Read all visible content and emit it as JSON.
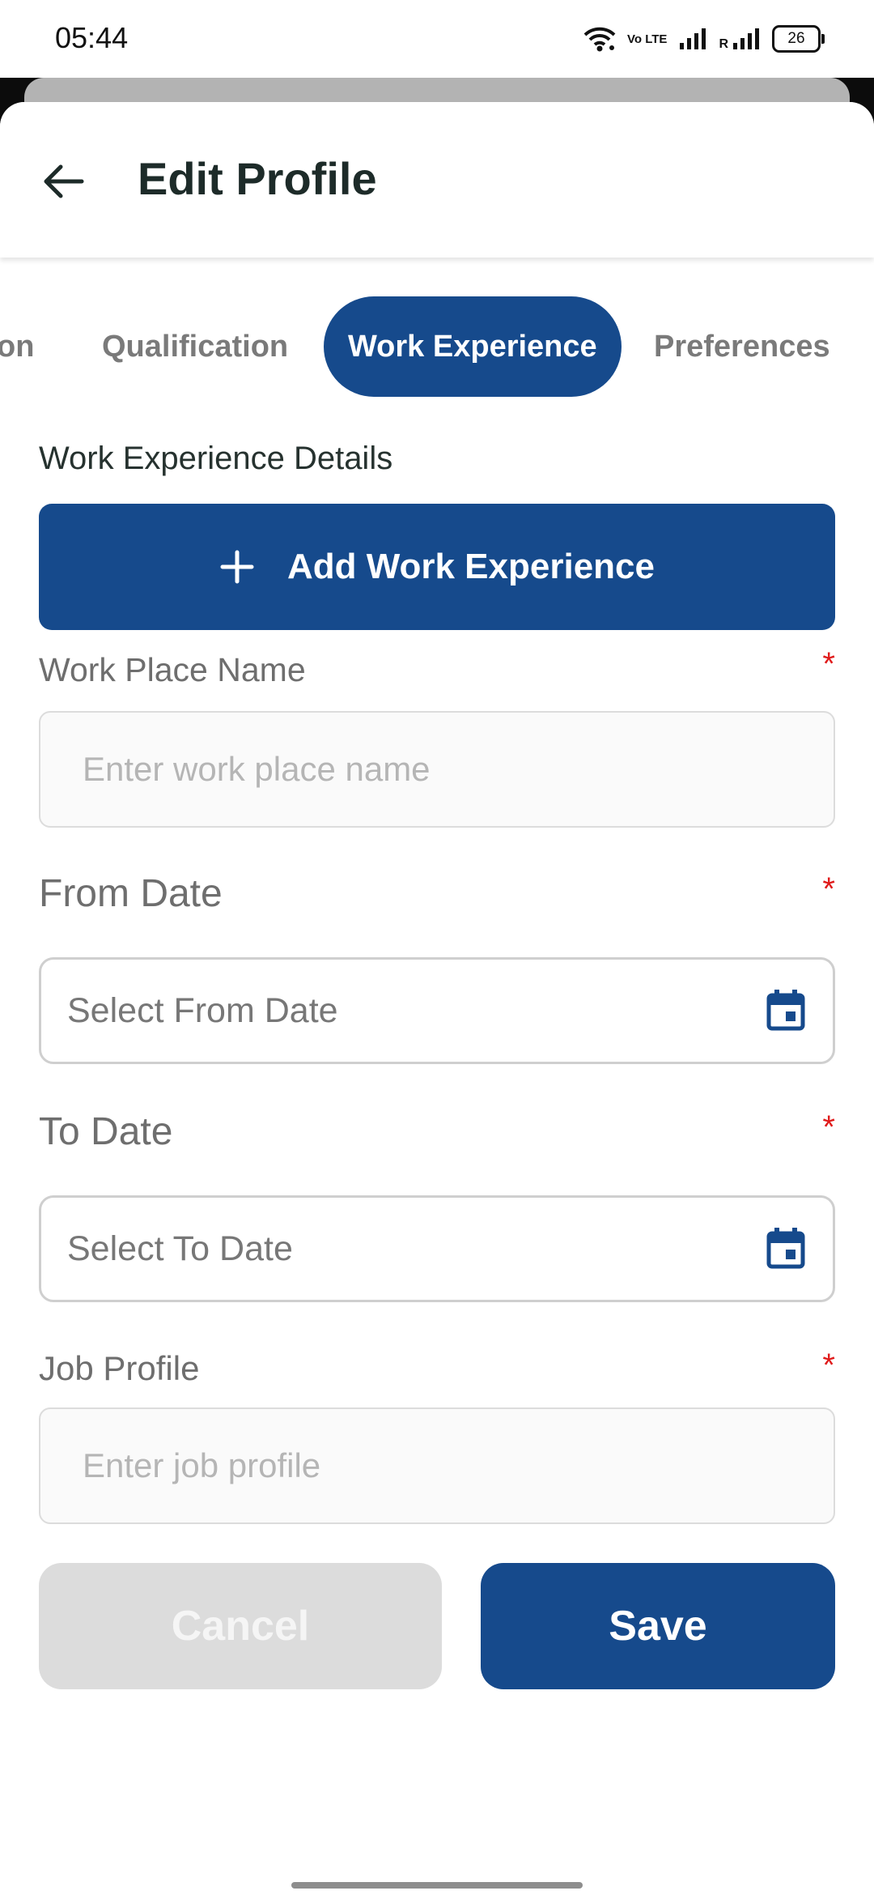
{
  "status_bar": {
    "time": "05:44",
    "volte": "Vo LTE",
    "roaming": "R",
    "battery": "26"
  },
  "header": {
    "title": "Edit Profile",
    "back_icon": "arrow-left-icon"
  },
  "tabs": [
    {
      "label": "on",
      "active": false
    },
    {
      "label": "Qualification",
      "active": false
    },
    {
      "label": "Work Experience",
      "active": true
    },
    {
      "label": "Preferences",
      "active": false
    }
  ],
  "section": {
    "title": "Work Experience Details"
  },
  "add_button": {
    "label": "Add Work Experience",
    "icon": "plus-icon"
  },
  "fields": {
    "work_place": {
      "label": "Work Place Name",
      "required": "*",
      "placeholder": "Enter work place name"
    },
    "from_date": {
      "label": "From Date",
      "required": "*",
      "placeholder": "Select From Date",
      "icon": "calendar-icon"
    },
    "to_date": {
      "label": "To Date",
      "required": "*",
      "placeholder": "Select To Date",
      "icon": "calendar-icon"
    },
    "job_profile": {
      "label": "Job Profile",
      "required": "*",
      "placeholder": "Enter job profile"
    }
  },
  "actions": {
    "cancel": "Cancel",
    "save": "Save"
  },
  "colors": {
    "primary": "#164a8c",
    "required": "#e01b1b",
    "disabled": "#dcdcdc"
  }
}
